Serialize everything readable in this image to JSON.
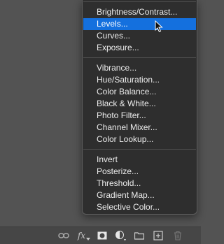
{
  "menu": {
    "groups": [
      {
        "items": [
          {
            "label": "Brightness/Contrast...",
            "selected": false
          },
          {
            "label": "Levels...",
            "selected": true
          },
          {
            "label": "Curves...",
            "selected": false
          },
          {
            "label": "Exposure...",
            "selected": false
          }
        ]
      },
      {
        "items": [
          {
            "label": "Vibrance...",
            "selected": false
          },
          {
            "label": "Hue/Saturation...",
            "selected": false
          },
          {
            "label": "Color Balance...",
            "selected": false
          },
          {
            "label": "Black & White...",
            "selected": false
          },
          {
            "label": "Photo Filter...",
            "selected": false
          },
          {
            "label": "Channel Mixer...",
            "selected": false
          },
          {
            "label": "Color Lookup...",
            "selected": false
          }
        ]
      },
      {
        "items": [
          {
            "label": "Invert",
            "selected": false
          },
          {
            "label": "Posterize...",
            "selected": false
          },
          {
            "label": "Threshold...",
            "selected": false
          },
          {
            "label": "Gradient Map...",
            "selected": false
          },
          {
            "label": "Selective Color...",
            "selected": false
          }
        ]
      }
    ]
  },
  "bottom_bar": {
    "fx_label": "fx",
    "icons": [
      "link-icon",
      "fx-icon",
      "mask-icon",
      "adjustment-layer-icon",
      "folder-icon",
      "new-layer-icon",
      "trash-icon"
    ]
  },
  "colors": {
    "selection": "#1470de",
    "menu_bg": "#2e2e2e",
    "panel_bg": "#535353"
  }
}
